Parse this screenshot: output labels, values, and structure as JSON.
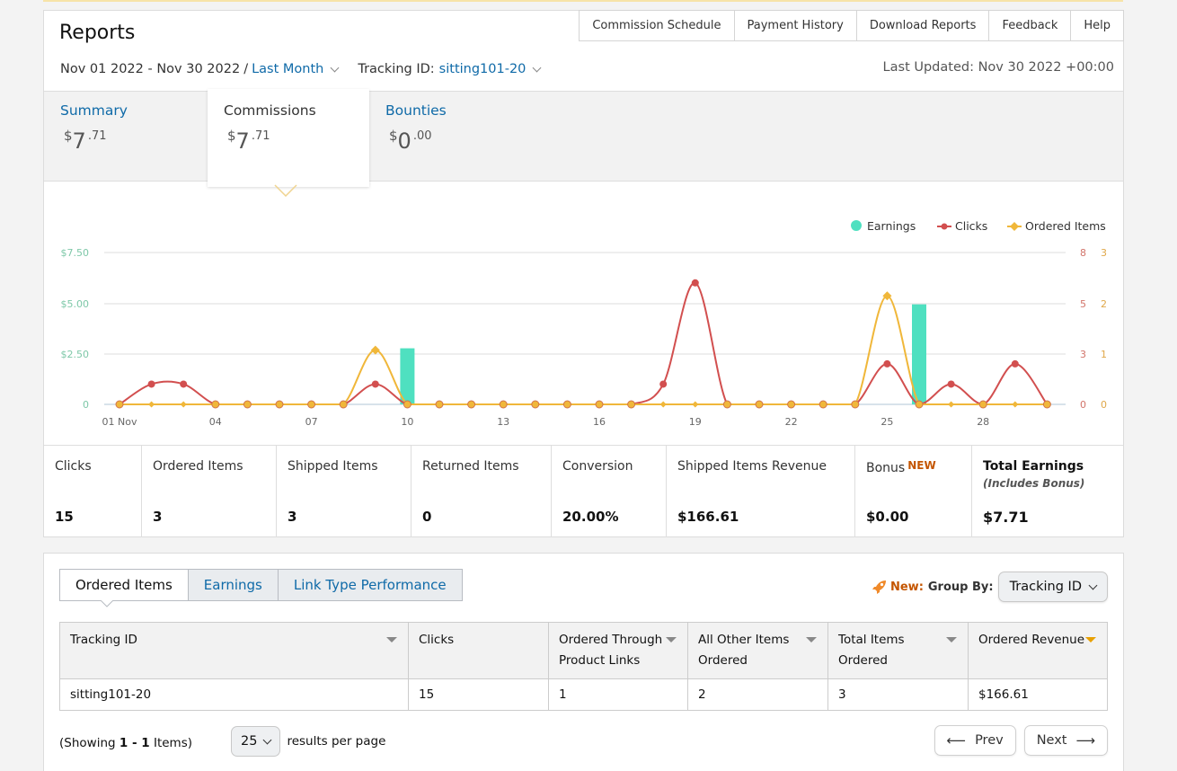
{
  "header": {
    "title": "Reports",
    "links": [
      "Commission Schedule",
      "Payment History",
      "Download Reports",
      "Feedback",
      "Help"
    ],
    "date_range": "Nov 01 2022 - Nov 30 2022",
    "date_sep": "/",
    "period": "Last Month",
    "tracking_label": "Tracking ID:",
    "tracking_value": "sitting101-20",
    "last_updated": "Last Updated: Nov 30 2022 +00:00"
  },
  "summary_tabs": [
    {
      "label": "Summary",
      "currency": "$",
      "whole": "7",
      "cents": ".71"
    },
    {
      "label": "Commissions",
      "currency": "$",
      "whole": "7",
      "cents": ".71"
    },
    {
      "label": "Bounties",
      "currency": "$",
      "whole": "0",
      "cents": ".00"
    }
  ],
  "chart_data": {
    "type": "line",
    "legend": [
      "Earnings",
      "Clicks",
      "Ordered Items"
    ],
    "legend_position": "top-right",
    "x_ticks": [
      "01 Nov",
      "04",
      "07",
      "10",
      "13",
      "16",
      "19",
      "22",
      "25",
      "28"
    ],
    "y_left_ticks": [
      "$7.50",
      "$5.00",
      "$2.50",
      "0"
    ],
    "y_right_clicks_ticks": [
      "8",
      "5",
      "3",
      "0"
    ],
    "y_right_items_ticks": [
      "3",
      "2",
      "1",
      "0"
    ],
    "days": [
      1,
      2,
      3,
      4,
      5,
      6,
      7,
      8,
      9,
      10,
      11,
      12,
      13,
      14,
      15,
      16,
      17,
      18,
      19,
      20,
      21,
      22,
      23,
      24,
      25,
      26,
      27,
      28,
      29,
      30
    ],
    "series": [
      {
        "name": "Earnings",
        "type": "bar",
        "color": "#4fe0c0",
        "values": [
          0,
          0,
          0,
          0,
          0,
          0,
          0,
          0,
          0,
          2.77,
          0,
          0,
          0,
          0,
          0,
          0,
          0,
          0,
          0,
          0,
          0,
          0,
          0,
          0,
          0,
          4.94,
          0,
          0,
          0,
          0
        ]
      },
      {
        "name": "Clicks",
        "type": "line",
        "color": "#d24f4f",
        "values": [
          0,
          1,
          1,
          0,
          0,
          0,
          0,
          0,
          1,
          0,
          0,
          0,
          0,
          0,
          0,
          0,
          0,
          1,
          6,
          0,
          0,
          0,
          0,
          0,
          2,
          0,
          1,
          0,
          2,
          0
        ]
      },
      {
        "name": "Ordered Items",
        "type": "line",
        "color": "#f0b73a",
        "values": [
          0,
          0,
          0,
          0,
          0,
          0,
          0,
          0,
          1,
          0,
          0,
          0,
          0,
          0,
          0,
          0,
          0,
          0,
          0,
          0,
          0,
          0,
          0,
          0,
          2,
          0,
          0,
          0,
          0,
          0
        ]
      }
    ],
    "ylim_earnings": [
      0,
      7.5
    ],
    "ylim_clicks": [
      0,
      7.5
    ],
    "ylim_items": [
      0,
      2.8
    ],
    "grid": true
  },
  "metrics": [
    {
      "label": "Clicks",
      "value": "15"
    },
    {
      "label": "Ordered Items",
      "value": "3"
    },
    {
      "label": "Shipped Items",
      "value": "3"
    },
    {
      "label": "Returned Items",
      "value": "0"
    },
    {
      "label": "Conversion",
      "value": "20.00%"
    },
    {
      "label": "Shipped Items Revenue",
      "value": "$166.61"
    },
    {
      "label": "Bonus",
      "badge": "NEW",
      "value": "$0.00"
    },
    {
      "label": "Total Earnings",
      "sub": "(Includes Bonus)",
      "value": "$7.71"
    }
  ],
  "bottom_tabs": [
    "Ordered Items",
    "Earnings",
    "Link Type Performance"
  ],
  "group_by": {
    "new_label": "New:",
    "label": "Group By:",
    "value": "Tracking ID"
  },
  "table": {
    "columns": [
      [
        "Tracking ID",
        ""
      ],
      [
        "Clicks",
        ""
      ],
      [
        "Ordered Through",
        "Product Links"
      ],
      [
        "All Other Items",
        "Ordered"
      ],
      [
        "Total Items",
        "Ordered"
      ],
      [
        "Ordered Revenue",
        ""
      ]
    ],
    "rows": [
      [
        "sitting101-20",
        "15",
        "1",
        "2",
        "3",
        "$166.61"
      ]
    ]
  },
  "pagination": {
    "showing_pre": "(Showing ",
    "showing_range": "1 - 1",
    "showing_post": " Items)",
    "per_page_value": "25",
    "per_page_label": "results per page",
    "prev": "Prev",
    "next": "Next"
  },
  "colors": {
    "link": "#0f6aa8",
    "earnings": "#4fe0c0",
    "clicks": "#d24f4f",
    "items": "#f0b73a",
    "accent_new": "#c45500"
  }
}
